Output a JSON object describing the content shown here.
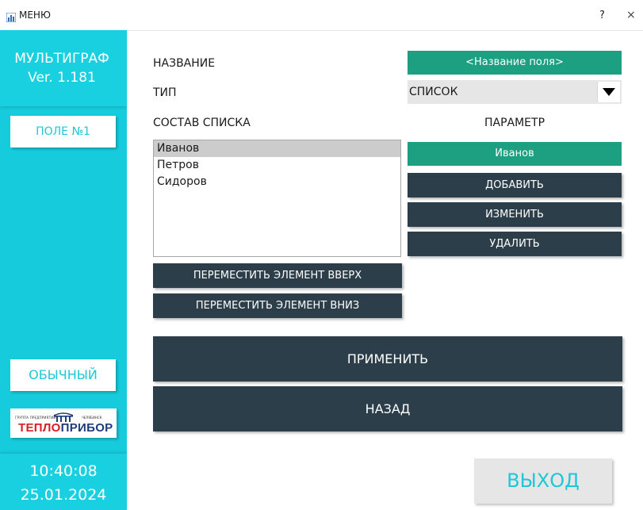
{
  "window": {
    "title": "МЕНЮ",
    "help": "?",
    "close": "×"
  },
  "sidebar": {
    "app_name": "МУЛЬТИГРАФ",
    "version": "Ver. 1.181",
    "field_button": "ПОЛЕ №1",
    "mode_button": "ОБЫЧНЫЙ",
    "logo": {
      "top_left": "ГРУППА ПРЕДПРИЯТИЙ",
      "top_right": "ЧЕЛЯБИНСК",
      "word_red": "ТЕПЛО",
      "word_blue": "ПРИБОР"
    },
    "time": "10:40:08",
    "date": "25.01.2024"
  },
  "form": {
    "name_label": "НАЗВАНИЕ",
    "name_value": "<Название поля>",
    "type_label": "ТИП",
    "type_value": "СПИСОК",
    "list_label": "СОСТАВ СПИСКА",
    "param_label": "ПАРАМЕТР",
    "list_items": [
      "Иванов",
      "Петров",
      "Сидоров"
    ],
    "param_value": "Иванов",
    "add": "ДОБАВИТЬ",
    "edit": "ИЗМЕНИТЬ",
    "delete": "УДАЛИТЬ",
    "move_up": "ПЕРЕМЕСТИТЬ ЭЛЕМЕНТ ВВЕРХ",
    "move_down": "ПЕРЕМЕСТИТЬ ЭЛЕМЕНТ ВНИЗ",
    "apply": "ПРИМЕНИТЬ",
    "back": "НАЗАД",
    "exit": "ВЫХОД"
  },
  "colors": {
    "cyan": "#16ccdc",
    "green": "#1d9f82",
    "dark": "#2c3e4a",
    "light_gray": "#e6e6e6"
  }
}
